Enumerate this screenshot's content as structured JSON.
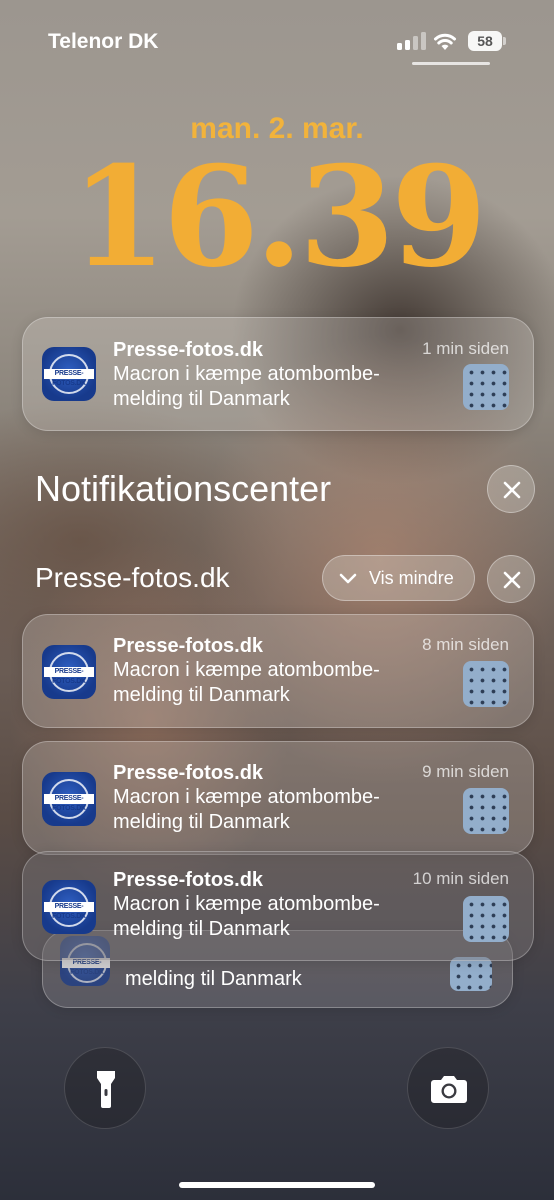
{
  "status_bar": {
    "carrier": "Telenor DK",
    "battery": "58"
  },
  "lock_screen": {
    "date": "man. 2. mar.",
    "time": "16.39"
  },
  "icons": {
    "app_icon_text": "PRESSE-FOTOS.DK",
    "close": "close-icon",
    "chevron": "chevron-down-icon",
    "flashlight": "flashlight-icon",
    "camera": "camera-icon"
  },
  "top_notification": {
    "app": "Presse-fotos.dk",
    "time": "1 min siden",
    "body": "Macron i kæmpe atombombe-melding til Danmark"
  },
  "notification_center": {
    "title": "Notifikationscenter",
    "group": {
      "name": "Presse-fotos.dk",
      "show_less_label": "Vis mindre",
      "items": [
        {
          "app": "Presse-fotos.dk",
          "time": "8 min siden",
          "body": "Macron i kæmpe atombombe-melding til Danmark"
        },
        {
          "app": "Presse-fotos.dk",
          "time": "9 min siden",
          "body": "Macron i kæmpe atombombe-melding til Danmark"
        },
        {
          "app": "Presse-fotos.dk",
          "time": "10 min siden",
          "body": "Macron i kæmpe atombombe-melding til Danmark"
        }
      ],
      "stacked_peek_body": "melding til Danmark"
    }
  },
  "colors": {
    "clock": "#f2ad35",
    "date": "#f2b33b",
    "app_icon": "#173a8c"
  }
}
